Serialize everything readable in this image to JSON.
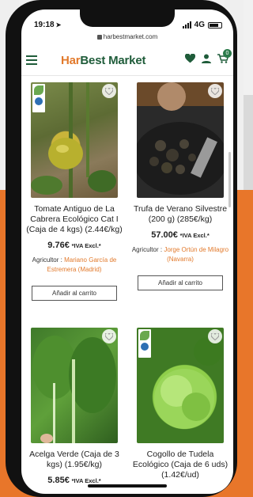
{
  "status": {
    "time": "19:18",
    "network": "4G"
  },
  "browser": {
    "url": "harbestmarket.com"
  },
  "header": {
    "logo_part1": "Har",
    "logo_part2": "Best Market",
    "cart_count": "0"
  },
  "products": [
    {
      "name": "Tomate Antiguo de La Cabrera Ecológico Cat I (Caja de 4 kgs) (2.44€/kg)",
      "price": "9.76€",
      "tax_note": "*IVA Excl.*",
      "farmer_label": "Agricultor :",
      "farmer": "Mariano García de Estremera (Madrid)",
      "button": "Añadir al carrito"
    },
    {
      "name": "Trufa de Verano Silvestre (200 g) (285€/kg)",
      "price": "57.00€",
      "tax_note": "*IVA Excl.*",
      "farmer_label": "Agricultor :",
      "farmer": "Jorge Ortún de Milagro (Navarra)",
      "button": "Añadir al carrito"
    },
    {
      "name": "Acelga Verde (Caja de 3 kgs) (1.95€/kg)",
      "price": "5.85€",
      "tax_note": "*IVA Excl.*"
    },
    {
      "name": "Cogollo de Tudela Ecológico (Caja de 6 uds) (1.42€/ud)"
    }
  ],
  "colors": {
    "brand_green": "#1f5c3a",
    "brand_orange": "#e27a2c"
  }
}
